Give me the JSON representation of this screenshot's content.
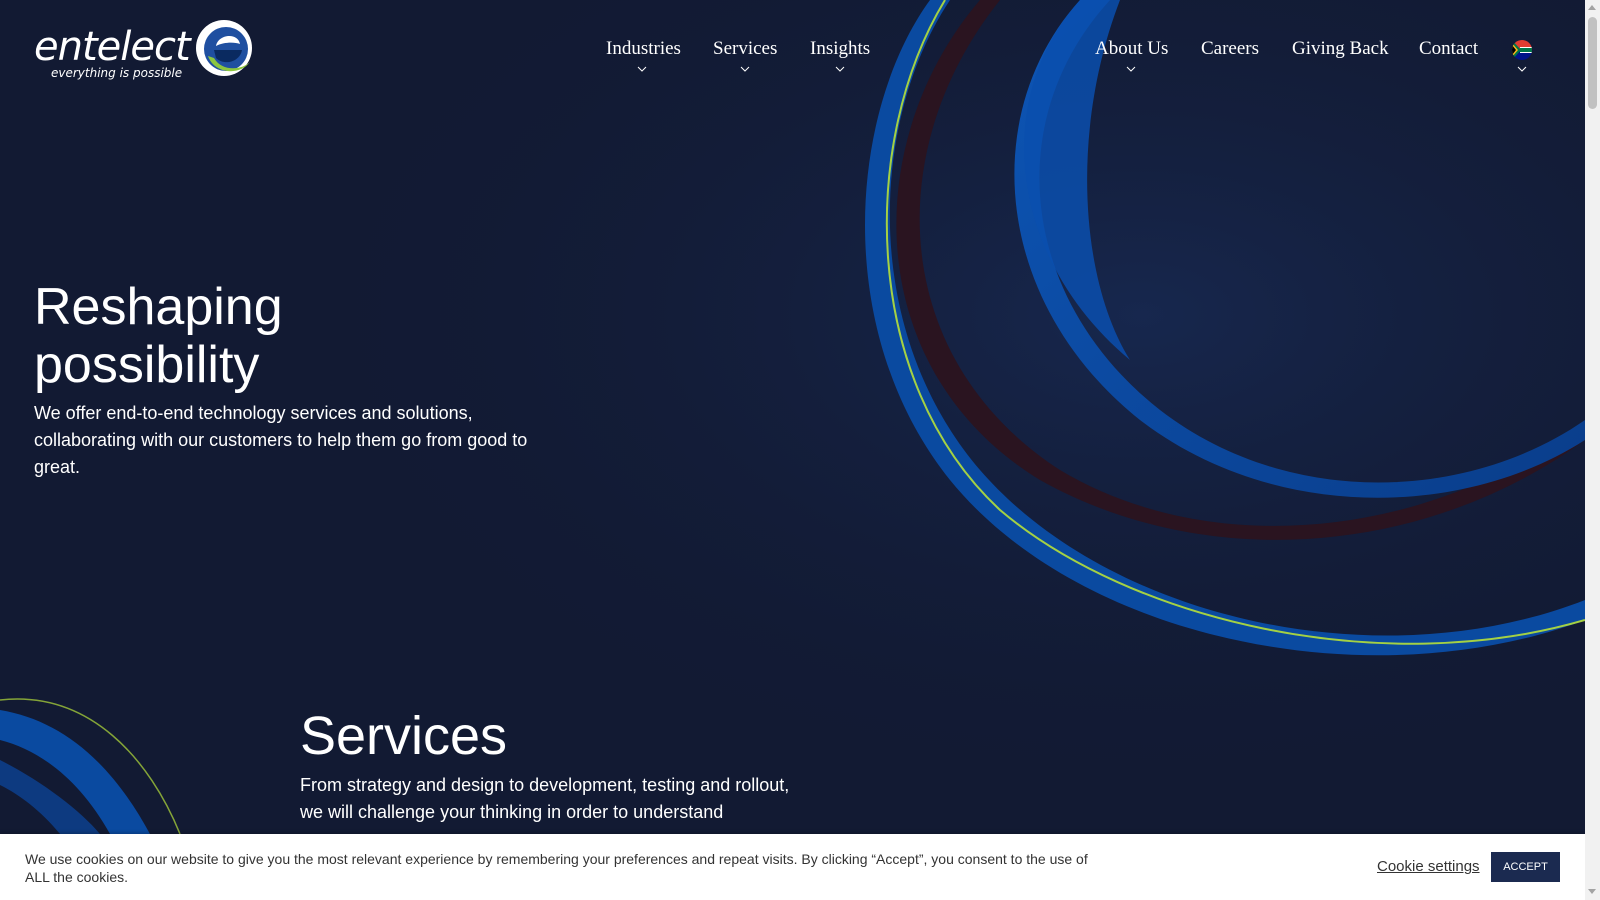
{
  "brand": {
    "name": "entelect",
    "tagline": "everything is possible"
  },
  "nav": {
    "items": [
      {
        "label": "Industries",
        "has_dropdown": true
      },
      {
        "label": "Services",
        "has_dropdown": true
      },
      {
        "label": "Insights",
        "has_dropdown": true
      },
      {
        "label": "About Us",
        "has_dropdown": true
      },
      {
        "label": "Careers",
        "has_dropdown": false
      },
      {
        "label": "Giving Back",
        "has_dropdown": false
      },
      {
        "label": "Contact",
        "has_dropdown": false
      }
    ],
    "language_icon": "south-africa-flag-icon"
  },
  "hero": {
    "title": "Reshaping possibility",
    "text": "We offer end-to-end technology services and solutions, collaborating with our customers to help them go from good to great."
  },
  "services": {
    "title": "Services",
    "text": "From strategy and design to development, testing and rollout, we will challenge your thinking in order to understand"
  },
  "cookie": {
    "text": "We use cookies on our website to give you the most relevant experience by remembering your preferences and repeat visits. By clicking “Accept”, you consent to the use of ALL the cookies.",
    "settings_label": "Cookie settings",
    "accept_label": "ACCEPT"
  },
  "colors": {
    "background": "#121a33",
    "swirl_blue": "#0a4aa0",
    "swirl_green": "#b5e03a",
    "swirl_dark_red": "#2a1420",
    "accept_button": "#1b2a50"
  }
}
